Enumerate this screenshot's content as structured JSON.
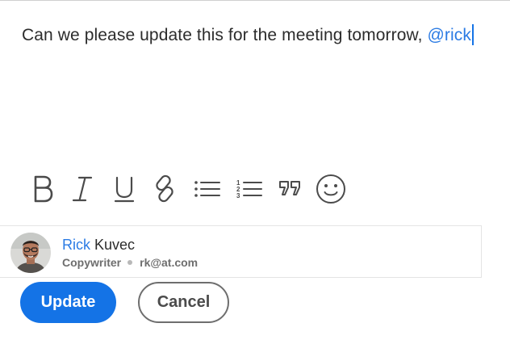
{
  "editor": {
    "text": "Can we please update this for the meeting tomorrow, ",
    "mention": "@rick"
  },
  "toolbar": {
    "tools": [
      "bold-icon",
      "italic-icon",
      "underline-icon",
      "link-icon",
      "bulleted-list-icon",
      "numbered-list-icon",
      "quote-icon",
      "emoji-icon"
    ]
  },
  "suggestion": {
    "name_match": "Rick",
    "name_rest": " Kuvec",
    "role": "Copywriter",
    "email": "rk@at.com"
  },
  "actions": {
    "update_label": "Update",
    "cancel_label": "Cancel"
  },
  "colors": {
    "accent": "#1473e6",
    "mention": "#2b7be4",
    "text": "#2c2c2c",
    "muted": "#6e6e6e"
  }
}
